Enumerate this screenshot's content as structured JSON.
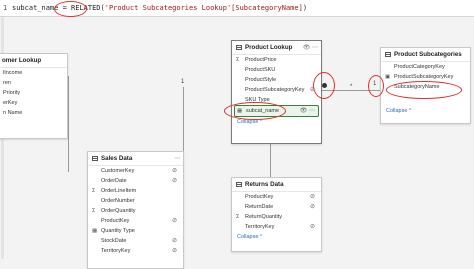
{
  "formula": {
    "line_number": "1",
    "code_start": "subcat_name = ",
    "code_fn": "RELATED(",
    "code_str": "'Product Subcategories Lookup'[SubcategoryName]",
    "code_end": ")"
  },
  "tables": {
    "customer": {
      "title": "omer Lookup",
      "fields": [
        "lIncome",
        "ren",
        "Priority",
        "erKey",
        "n Name"
      ]
    },
    "product": {
      "title": "Product Lookup",
      "fields": [
        "ProductPrice",
        "ProductSKU",
        "ProductStyle",
        "ProductSubcategoryKey",
        "SKU Type"
      ],
      "highlight_field": "subcat_name",
      "collapse": "Collapse"
    },
    "subcat": {
      "title": "Product Subcategories",
      "fields": [
        "ProductCategoryKey",
        "ProductSubcategoryKey",
        "SubcategoryName"
      ],
      "collapse": "Collapse"
    },
    "sales": {
      "title": "Sales Data",
      "fields": [
        "CustomerKey",
        "OrderDate",
        "OrderLineItem",
        "OrderNumber",
        "OrderQuantity",
        "ProductKey",
        "Quantity Type",
        "StockDate",
        "TerritoryKey"
      ]
    },
    "returns": {
      "title": "Returns Data",
      "fields": [
        "ProductKey",
        "ReturnDate",
        "ReturnQuantity",
        "TerritoryKey"
      ],
      "collapse": "Collapse"
    }
  },
  "markers": {
    "one": "1",
    "many": "*",
    "one_b": "1"
  },
  "icons": {
    "eye": "eye-icon",
    "hide": "hide-icon",
    "more": "more-icon",
    "sigma": "sigma-icon",
    "calc_column": "calculated-column-icon"
  }
}
